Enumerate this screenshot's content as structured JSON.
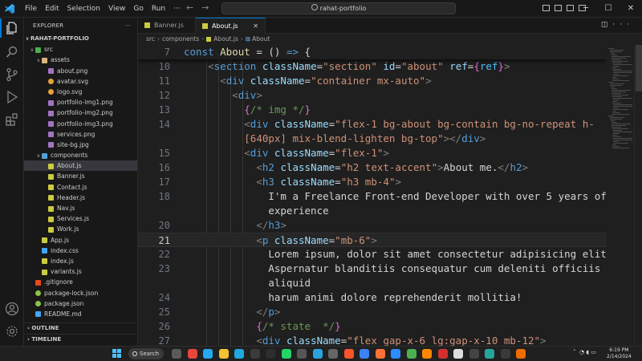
{
  "titlebar": {
    "menu": [
      "File",
      "Edit",
      "Selection",
      "View",
      "Go",
      "Run",
      "···"
    ],
    "search": "rahat-portfolio"
  },
  "sidebar": {
    "header": "EXPLORER",
    "project": "RAHAT-PORTFOLIO",
    "tree": [
      {
        "label": "src",
        "depth": 0,
        "type": "folder-src",
        "chevron": "∨"
      },
      {
        "label": "assets",
        "depth": 1,
        "type": "folder",
        "chevron": "∨"
      },
      {
        "label": "about.png",
        "depth": 2,
        "type": "image"
      },
      {
        "label": "avatar.svg",
        "depth": 2,
        "type": "svg"
      },
      {
        "label": "logo.svg",
        "depth": 2,
        "type": "svg"
      },
      {
        "label": "portfolio-img1.png",
        "depth": 2,
        "type": "image"
      },
      {
        "label": "portfolio-img2.png",
        "depth": 2,
        "type": "image"
      },
      {
        "label": "portfolio-img3.png",
        "depth": 2,
        "type": "image"
      },
      {
        "label": "services.png",
        "depth": 2,
        "type": "image"
      },
      {
        "label": "site-bg.jpg",
        "depth": 2,
        "type": "image"
      },
      {
        "label": "components",
        "depth": 1,
        "type": "folder-comp",
        "chevron": "∨"
      },
      {
        "label": "About.js",
        "depth": 2,
        "type": "js",
        "selected": true
      },
      {
        "label": "Banner.js",
        "depth": 2,
        "type": "js"
      },
      {
        "label": "Contact.js",
        "depth": 2,
        "type": "js"
      },
      {
        "label": "Header.js",
        "depth": 2,
        "type": "js"
      },
      {
        "label": "Nav.js",
        "depth": 2,
        "type": "js"
      },
      {
        "label": "Services.js",
        "depth": 2,
        "type": "js"
      },
      {
        "label": "Work.js",
        "depth": 2,
        "type": "js"
      },
      {
        "label": "App.js",
        "depth": 1,
        "type": "js"
      },
      {
        "label": "index.css",
        "depth": 1,
        "type": "css"
      },
      {
        "label": "index.js",
        "depth": 1,
        "type": "js"
      },
      {
        "label": "variants.js",
        "depth": 1,
        "type": "js"
      },
      {
        "label": ".gitignore",
        "depth": 0,
        "type": "git"
      },
      {
        "label": "package-lock.json",
        "depth": 0,
        "type": "json"
      },
      {
        "label": "package.json",
        "depth": 0,
        "type": "json"
      },
      {
        "label": "README.md",
        "depth": 0,
        "type": "md"
      }
    ],
    "outline": "OUTLINE",
    "timeline": "TIMELINE"
  },
  "tabs": [
    {
      "label": "Banner.js",
      "active": false
    },
    {
      "label": "About.js",
      "active": true
    }
  ],
  "breadcrumb": [
    "src",
    "components",
    "About.js",
    "About"
  ],
  "editor": {
    "active_line": 21,
    "lines": [
      {
        "n": "7",
        "sticky": true,
        "indent": 0,
        "tokens": [
          [
            "kw",
            "const "
          ],
          [
            "fn",
            "About"
          ],
          [
            "tx",
            " = () "
          ],
          [
            "kw",
            "=>"
          ],
          [
            "tx",
            " {"
          ]
        ]
      },
      {
        "n": "10",
        "indent": 2,
        "tokens": [
          [
            "tg",
            "<"
          ],
          [
            "tn",
            "section"
          ],
          [
            "tx",
            " "
          ],
          [
            "at",
            "className"
          ],
          [
            "tx",
            "="
          ],
          [
            "st",
            "\"section\""
          ],
          [
            "tx",
            " "
          ],
          [
            "at",
            "id"
          ],
          [
            "tx",
            "="
          ],
          [
            "st",
            "\"about\""
          ],
          [
            "tx",
            " "
          ],
          [
            "at",
            "ref"
          ],
          [
            "tx",
            "="
          ],
          [
            "br",
            "{"
          ],
          [
            "vr",
            "ref"
          ],
          [
            "br",
            "}"
          ],
          [
            "tg",
            ">"
          ]
        ]
      },
      {
        "n": "11",
        "indent": 3,
        "tokens": [
          [
            "tg",
            "<"
          ],
          [
            "tn",
            "div"
          ],
          [
            "tx",
            " "
          ],
          [
            "at",
            "className"
          ],
          [
            "tx",
            "="
          ],
          [
            "st",
            "\"container mx-auto\""
          ],
          [
            "tg",
            ">"
          ]
        ]
      },
      {
        "n": "12",
        "indent": 4,
        "tokens": [
          [
            "tg",
            "<"
          ],
          [
            "tn",
            "div"
          ],
          [
            "tg",
            ">"
          ]
        ]
      },
      {
        "n": "13",
        "indent": 5,
        "tokens": [
          [
            "br",
            "{"
          ],
          [
            "cm",
            "/* img */"
          ],
          [
            "br",
            "}"
          ]
        ]
      },
      {
        "n": "14",
        "indent": 5,
        "tokens": [
          [
            "tg",
            "<"
          ],
          [
            "tn",
            "div"
          ],
          [
            "tx",
            " "
          ],
          [
            "at",
            "className"
          ],
          [
            "tx",
            "="
          ],
          [
            "st",
            "\"flex-1 bg-about bg-contain bg-no-repeat h-"
          ]
        ]
      },
      {
        "n": "",
        "indent": 5,
        "tokens": [
          [
            "st",
            "[640px] mix-blend-lighten bg-top\""
          ],
          [
            "tg",
            ">"
          ],
          [
            "tg",
            "</"
          ],
          [
            "tn",
            "div"
          ],
          [
            "tg",
            ">"
          ]
        ]
      },
      {
        "n": "15",
        "indent": 5,
        "tokens": [
          [
            "tg",
            "<"
          ],
          [
            "tn",
            "div"
          ],
          [
            "tx",
            " "
          ],
          [
            "at",
            "className"
          ],
          [
            "tx",
            "="
          ],
          [
            "st",
            "\"flex-1\""
          ],
          [
            "tg",
            ">"
          ]
        ]
      },
      {
        "n": "16",
        "indent": 6,
        "tokens": [
          [
            "tg",
            "<"
          ],
          [
            "tn",
            "h2"
          ],
          [
            "tx",
            " "
          ],
          [
            "at",
            "className"
          ],
          [
            "tx",
            "="
          ],
          [
            "st",
            "\"h2 text-accent\""
          ],
          [
            "tg",
            ">"
          ],
          [
            "tx",
            "About me."
          ],
          [
            "tg",
            "</"
          ],
          [
            "tn",
            "h2"
          ],
          [
            "tg",
            ">"
          ]
        ]
      },
      {
        "n": "17",
        "indent": 6,
        "tokens": [
          [
            "tg",
            "<"
          ],
          [
            "tn",
            "h3"
          ],
          [
            "tx",
            " "
          ],
          [
            "at",
            "className"
          ],
          [
            "tx",
            "="
          ],
          [
            "st",
            "\"h3 mb-4\""
          ],
          [
            "tg",
            ">"
          ]
        ]
      },
      {
        "n": "18",
        "indent": 7,
        "tokens": [
          [
            "tx",
            "I'm a Freelance Front-end Developer with over 5 years of"
          ]
        ]
      },
      {
        "n": "",
        "indent": 7,
        "tokens": [
          [
            "tx",
            "experience"
          ]
        ]
      },
      {
        "n": "20",
        "indent": 6,
        "tokens": [
          [
            "tg",
            "</"
          ],
          [
            "tn",
            "h3"
          ],
          [
            "tg",
            ">"
          ]
        ]
      },
      {
        "n": "21",
        "indent": 6,
        "active": true,
        "tokens": [
          [
            "tg",
            "<"
          ],
          [
            "tn",
            "p"
          ],
          [
            "tx",
            " "
          ],
          [
            "at",
            "className"
          ],
          [
            "tx",
            "="
          ],
          [
            "st",
            "\"mb-6\""
          ],
          [
            "tg",
            ">"
          ]
        ]
      },
      {
        "n": "22",
        "indent": 7,
        "tokens": [
          [
            "tx",
            "Lorem ipsum, dolor sit amet consectetur adipisicing elit."
          ]
        ]
      },
      {
        "n": "23",
        "indent": 7,
        "tokens": [
          [
            "tx",
            "Aspernatur blanditiis consequatur cum deleniti officiis"
          ]
        ]
      },
      {
        "n": "",
        "indent": 7,
        "tokens": [
          [
            "tx",
            "aliquid"
          ]
        ]
      },
      {
        "n": "24",
        "indent": 7,
        "tokens": [
          [
            "tx",
            "harum animi dolore reprehenderit mollitia!"
          ]
        ]
      },
      {
        "n": "25",
        "indent": 6,
        "tokens": [
          [
            "tg",
            "</"
          ],
          [
            "tn",
            "p"
          ],
          [
            "tg",
            ">"
          ]
        ]
      },
      {
        "n": "26",
        "indent": 6,
        "tokens": [
          [
            "br",
            "{"
          ],
          [
            "cm",
            "/* state  */"
          ],
          [
            "br",
            "}"
          ]
        ]
      },
      {
        "n": "27",
        "indent": 6,
        "tokens": [
          [
            "tg",
            "<"
          ],
          [
            "tn",
            "div"
          ],
          [
            "tx",
            " "
          ],
          [
            "at",
            "className"
          ],
          [
            "tx",
            "="
          ],
          [
            "st",
            "\"flex gap-x-6 lg:gap-x-10 mb-12\""
          ],
          [
            "tg",
            ">"
          ]
        ]
      }
    ]
  },
  "taskbar": {
    "search": "Search",
    "time": "6:19 PM",
    "date": "2/14/2024",
    "apps": [
      {
        "name": "task-view",
        "color": "#5a5a5a"
      },
      {
        "name": "chrome",
        "color": "#e8453c"
      },
      {
        "name": "vscode",
        "color": "#23a9f2"
      },
      {
        "name": "file-explorer",
        "color": "#f4c430"
      },
      {
        "name": "edge",
        "color": "#1fa8e0"
      },
      {
        "name": "app-dark",
        "color": "#3b3b3b"
      },
      {
        "name": "terminal",
        "color": "#2d2d2d"
      },
      {
        "name": "whatsapp",
        "color": "#25d366"
      },
      {
        "name": "app-gray",
        "color": "#555555"
      },
      {
        "name": "telegram",
        "color": "#2aa3df"
      },
      {
        "name": "app-gray-2",
        "color": "#666666"
      },
      {
        "name": "brave",
        "color": "#fb542b"
      },
      {
        "name": "app-blue",
        "color": "#3b82f6"
      },
      {
        "name": "firefox",
        "color": "#ff7139"
      },
      {
        "name": "zoom",
        "color": "#2d8cff"
      },
      {
        "name": "app-green",
        "color": "#4caf50"
      },
      {
        "name": "vlc",
        "color": "#ff8800"
      },
      {
        "name": "app-red",
        "color": "#d32f2f"
      },
      {
        "name": "app-white",
        "color": "#dddddd"
      },
      {
        "name": "app-dark-2",
        "color": "#444444"
      },
      {
        "name": "app-teal",
        "color": "#26a69a"
      },
      {
        "name": "app-dark-3",
        "color": "#3a3a3a"
      },
      {
        "name": "app-orange",
        "color": "#ef6c00"
      }
    ]
  }
}
